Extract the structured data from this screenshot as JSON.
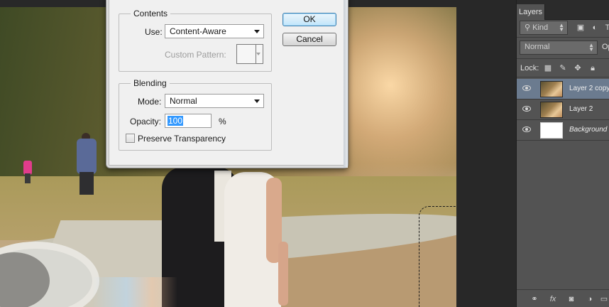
{
  "dialog": {
    "contents_title": "Contents",
    "use_label": "Use:",
    "use_value": "Content-Aware",
    "custom_pattern_label": "Custom Pattern:",
    "blending_title": "Blending",
    "mode_label": "Mode:",
    "mode_value": "Normal",
    "opacity_label": "Opacity:",
    "opacity_value": "100",
    "opacity_unit": "%",
    "preserve_transparency_label": "Preserve Transparency",
    "preserve_transparency_checked": false,
    "ok_label": "OK",
    "cancel_label": "Cancel"
  },
  "layers_panel": {
    "tab_label": "Layers",
    "filter_label": "Kind",
    "blend_mode": "Normal",
    "opacity_partial": "Op",
    "lock_label": "Lock:",
    "layers": [
      {
        "name": "Layer 2 copy",
        "visible": true,
        "selected": true,
        "thumbnail": "photo"
      },
      {
        "name": "Layer 2",
        "visible": true,
        "selected": false,
        "thumbnail": "photo"
      },
      {
        "name": "Background",
        "visible": true,
        "selected": false,
        "thumbnail": "white",
        "italic": true
      }
    ],
    "footer_icons": [
      "link-icon",
      "fx-icon",
      "mask-icon",
      "adjustment-icon",
      "folder-icon",
      "new-layer-icon"
    ]
  },
  "colors": {
    "panel_bg": "#535353",
    "selected_layer": "#6b7b8f",
    "dialog_bg": "#f0f0f0",
    "selection_highlight": "#3399ff"
  }
}
